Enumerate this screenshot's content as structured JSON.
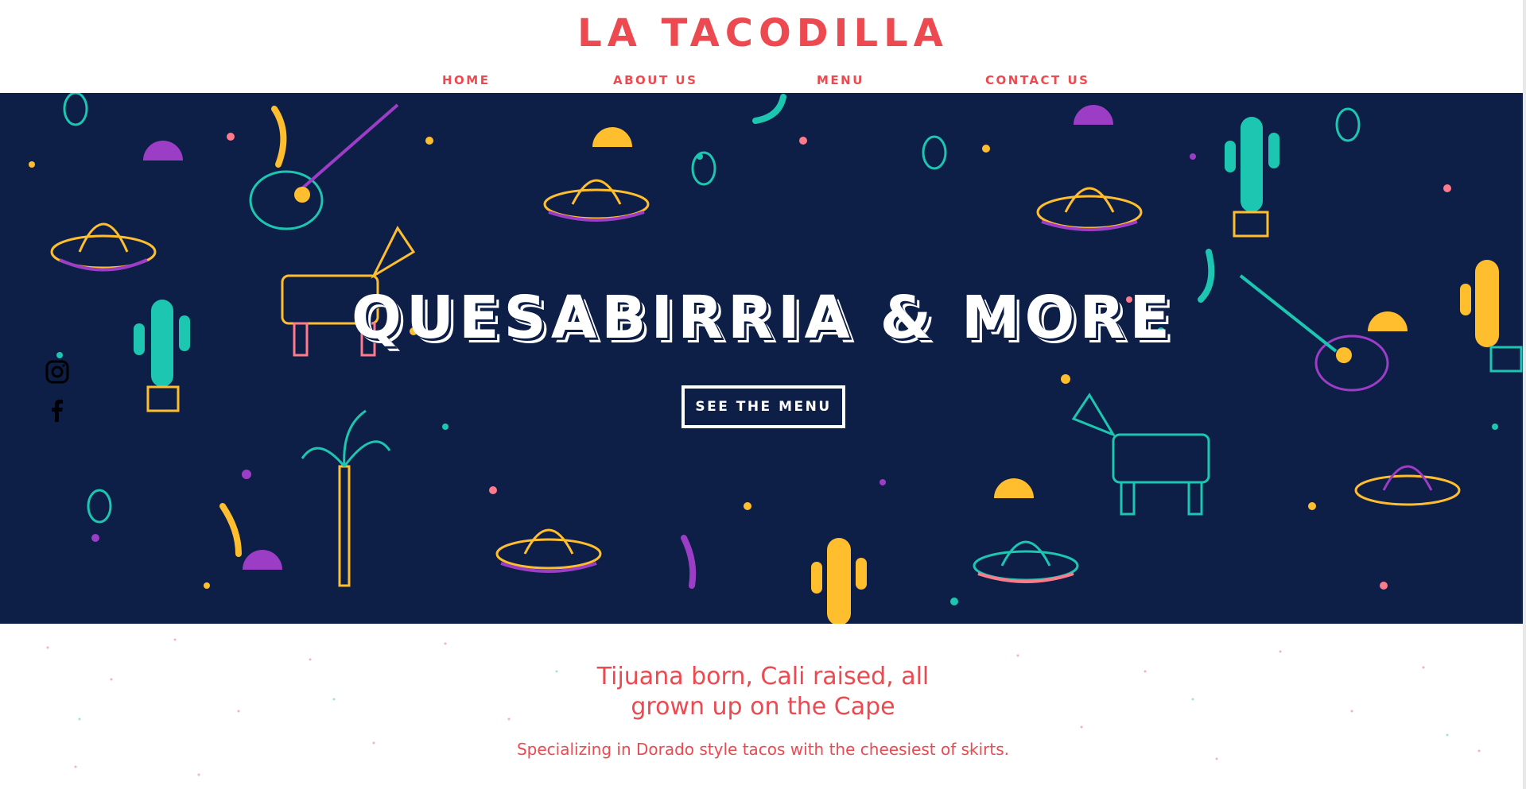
{
  "header": {
    "brand": "LA TACODILLA",
    "nav": [
      "HOME",
      "ABOUT US",
      "MENU",
      "CONTACT US"
    ]
  },
  "hero": {
    "title": "QUESABIRRIA & MORE",
    "cta_label": "SEE THE MENU",
    "social_icons": [
      "instagram-icon",
      "facebook-icon"
    ]
  },
  "intro": {
    "tagline_line1": "Tijuana born, Cali raised, all",
    "tagline_line2": "grown up on the Cape",
    "subtagline": "Specializing in Dorado style tacos with the cheesiest of skirts."
  },
  "colors": {
    "brand_red": "#ec4a50",
    "hero_navy": "#0d1e47",
    "accent_teal": "#1cc6b1",
    "accent_yellow": "#ffbe2e",
    "accent_purple": "#9b3dc5",
    "accent_pink": "#ff7a8a"
  }
}
